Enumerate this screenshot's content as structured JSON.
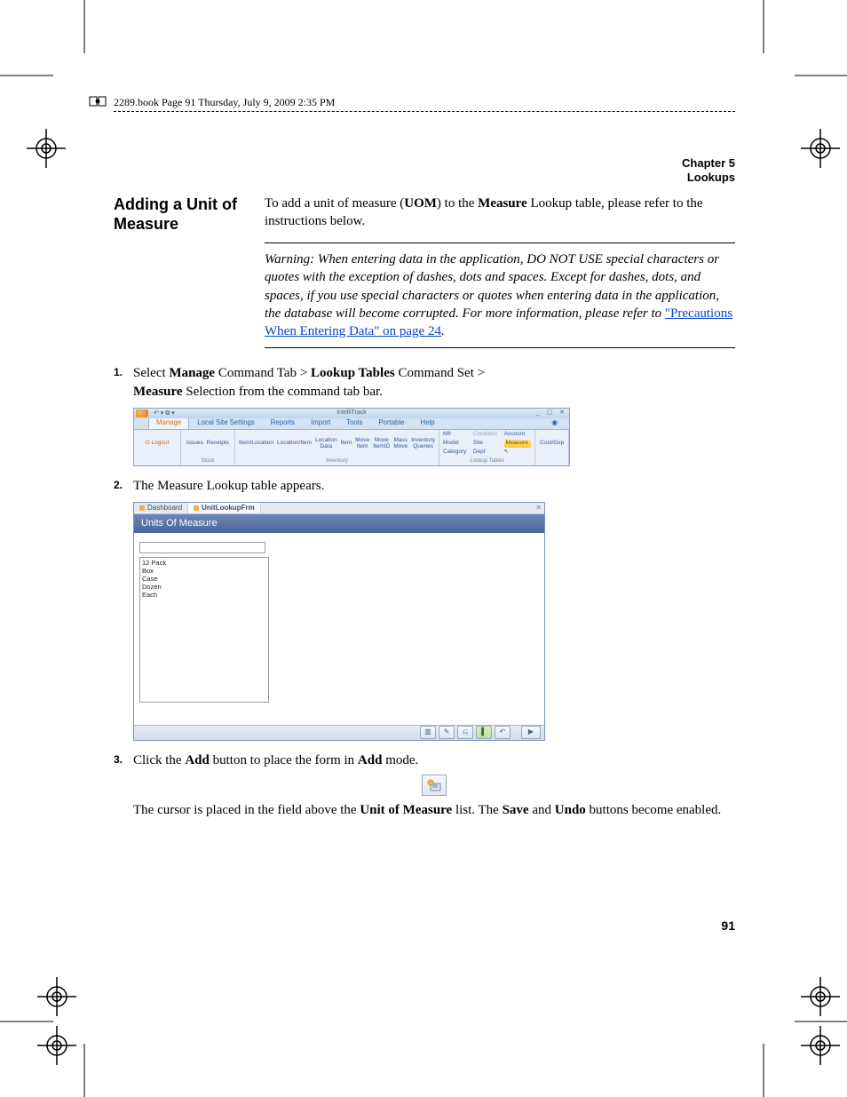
{
  "header": {
    "crop_text": "2289.book  Page 91  Thursday, July 9, 2009  2:35 PM"
  },
  "chapter": {
    "line1": "Chapter 5",
    "line2": "Lookups"
  },
  "margin_heading": "Adding a Unit of Measure",
  "intro": {
    "pre": "To add a unit of measure (",
    "uom_abbrev": "UOM",
    "mid": ") to the ",
    "measure_word": "Measure",
    "post": " Lookup table, please refer to the instructions below."
  },
  "warning": {
    "body": "Warning:   When entering data in the application, DO NOT USE special characters or quotes with the exception of dashes, dots and spaces. Except for dashes, dots, and spaces, if you use special characters or quotes when entering data in the application, the database will become corrupted. For more information, please refer to ",
    "link": "\"Precautions When Entering Data\" on page 24",
    "tail": "."
  },
  "steps": {
    "s1": {
      "num": "1.",
      "t1": "Select ",
      "b1": "Manage",
      "t2": " Command Tab > ",
      "b2": "Lookup Tables",
      "t3": " Command Set > ",
      "b3": "Measure",
      "t4": " Selection from the command tab bar."
    },
    "s2": {
      "num": "2.",
      "text": "The Measure Lookup table appears."
    },
    "s3": {
      "num": "3.",
      "t1": "Click the ",
      "b1": "Add",
      "t2": " button to place the form in ",
      "b2": "Add",
      "t3": " mode."
    },
    "s3b": {
      "t1": "The cursor is placed in the field above the ",
      "b1": "Unit of Measure",
      "t2": " list. The ",
      "b2": "Save",
      "t3": " and ",
      "b3": "Undo",
      "t4": " buttons become enabled."
    }
  },
  "ribbon": {
    "title": "IntelliTrack",
    "tabs": {
      "manage": "Manage",
      "lss": "Local Site Settings",
      "reports": "Reports",
      "import": "Import",
      "tools": "Tools",
      "portable": "Portable",
      "help": "Help"
    },
    "logout": "Logout",
    "stock": {
      "issues": "Issues",
      "receipts": "Receipts",
      "label": "Stock"
    },
    "inventory": {
      "a": "Item/Location",
      "b": "Location/Item",
      "c": "Location\nData",
      "d": "Item",
      "e": "Move\nItem",
      "f": "Move\nItemID",
      "g": "Mass\nMove",
      "h": "Inventory Queries",
      "label": "Inventory"
    },
    "lookup": {
      "r1c1": "Mfr",
      "r1c2": "Condition",
      "r1c3": "Account",
      "r2c1": "Model",
      "r2c2": "Site",
      "r2c3": "Measure",
      "r3c1": "Category",
      "r3c2": "Dept",
      "label": "Lookup Tables",
      "cost": "Cost/Gxp"
    }
  },
  "uom": {
    "tab_dash": "Dashboard",
    "tab_form": "UnitLookupFrm",
    "title": "Units Of Measure",
    "items": [
      "12 Pack",
      "Box",
      "Case",
      "Dozen",
      "Each"
    ]
  },
  "page_number": "91"
}
